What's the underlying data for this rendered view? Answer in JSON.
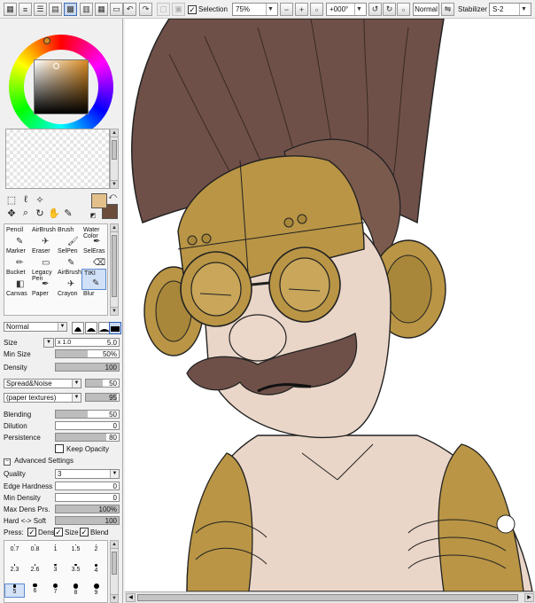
{
  "toolbar": {
    "selection_label": "Selection",
    "selection_checked": true,
    "zoom_value": "75%",
    "rotation_value": "+000°",
    "blend_value": "Normal",
    "stabilizer_label": "Stabilizer",
    "stabilizer_value": "S-2"
  },
  "colors": {
    "foreground": "#e3c08a",
    "background": "#6b4b3a",
    "selected_hue": "#d98a20"
  },
  "tools": [
    {
      "label": "Pencil",
      "icon": "pencil-icon"
    },
    {
      "label": "AirBrush",
      "icon": "airbrush-icon"
    },
    {
      "label": "Brush",
      "icon": "brush-icon"
    },
    {
      "label": "Water Color",
      "icon": "watercolor-icon"
    },
    {
      "label": "Marker",
      "icon": "marker-icon"
    },
    {
      "label": "Eraser",
      "icon": "eraser-icon"
    },
    {
      "label": "SelPen",
      "icon": "selpen-icon"
    },
    {
      "label": "SelEras",
      "icon": "seleras-icon"
    },
    {
      "label": "Bucket",
      "icon": "bucket-icon"
    },
    {
      "label": "Legacy Pen",
      "icon": "legacy-pen-icon"
    },
    {
      "label": "AirBrush",
      "icon": "airbrush-icon"
    },
    {
      "label": "TIKI",
      "icon": "tiki-icon"
    },
    {
      "label": "Canvas",
      "icon": ""
    },
    {
      "label": "Paper",
      "icon": ""
    },
    {
      "label": "Crayon",
      "icon": ""
    },
    {
      "label": "Blur",
      "icon": ""
    }
  ],
  "brush": {
    "blend_mode": "Normal",
    "size_label": "Size",
    "size_multiplier": "x 1.0",
    "size_value": "5.0",
    "min_size_label": "Min Size",
    "min_size_value": "50%",
    "min_size_fraction": 0.5,
    "density_label": "Density",
    "density_value": "100",
    "density_fraction": 1.0,
    "texture1_name": "Spread&Noise",
    "texture1_value": "50",
    "texture1_fraction": 0.5,
    "texture2_name": "(paper textures)",
    "texture2_value": "95",
    "texture2_fraction": 0.95,
    "blending_label": "Blending",
    "blending_value": "50",
    "blending_fraction": 0.5,
    "dilution_label": "Dilution",
    "dilution_value": "0",
    "dilution_fraction": 0.0,
    "persistence_label": "Persistence",
    "persistence_value": "80",
    "persistence_fraction": 0.8,
    "keep_opacity_label": "Keep Opacity",
    "keep_opacity_checked": false,
    "advanced_label": "Advanced Settings",
    "quality_label": "Quality",
    "quality_value": "3",
    "edge_hardness_label": "Edge Hardness",
    "edge_hardness_value": "0",
    "edge_hardness_fraction": 0.0,
    "min_density_label": "Min Density",
    "min_density_value": "0",
    "min_density_fraction": 0.0,
    "max_dens_label": "Max Dens Prs.",
    "max_dens_value": "100%",
    "max_dens_fraction": 1.0,
    "hard_soft_label": "Hard <-> Soft",
    "hard_soft_value": "100",
    "hard_soft_fraction": 1.0,
    "press_label": "Press:",
    "press_dens_label": "Dens",
    "press_size_label": "Size",
    "press_blend_label": "Blend"
  },
  "dot_sizes": [
    "0.7",
    "0.8",
    "1",
    "1.5",
    "2",
    "2.3",
    "2.6",
    "3",
    "3.5",
    "4",
    "5",
    "6",
    "7",
    "8",
    "9"
  ],
  "dot_sizes_selected": "5"
}
